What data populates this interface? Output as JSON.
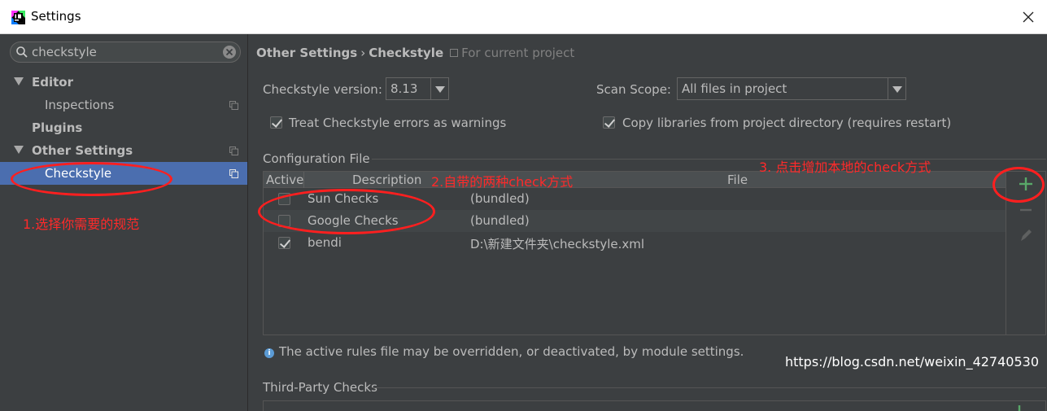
{
  "window": {
    "title": "Settings"
  },
  "search": {
    "value": "checkstyle"
  },
  "tree": {
    "editor": "Editor",
    "inspections": "Inspections",
    "plugins": "Plugins",
    "other_settings": "Other Settings",
    "checkstyle": "Checkstyle"
  },
  "breadcrumb": {
    "parent": "Other Settings",
    "separator": "›",
    "current": "Checkstyle",
    "scope_note": "For current project"
  },
  "form": {
    "version_label": "Checkstyle version:",
    "version_value": "8.13",
    "scope_label": "Scan Scope:",
    "scope_value": "All files in project",
    "treat_errors_label": "Treat Checkstyle errors as warnings",
    "treat_errors_checked": true,
    "copy_libs_label": "Copy libraries from project directory (requires restart)",
    "copy_libs_checked": true
  },
  "config": {
    "section_title": "Configuration File",
    "columns": {
      "active": "Active",
      "description": "Description",
      "file": "File"
    },
    "rows": [
      {
        "active": false,
        "description": "Sun Checks",
        "file": "(bundled)"
      },
      {
        "active": false,
        "description": "Google Checks",
        "file": "(bundled)"
      },
      {
        "active": true,
        "description": "bendi",
        "file": "D:\\新建文件夹\\checkstyle.xml"
      }
    ],
    "tools": {
      "add": "plus-icon",
      "remove": "minus-icon",
      "edit": "pencil-icon"
    }
  },
  "info_text": "The active rules file may be overridden, or deactivated, by module settings.",
  "third_party": {
    "section_title": "Third-Party Checks"
  },
  "annotations": {
    "a1": "1.选择你需要的规范",
    "a2": "2.自带的两种check方式",
    "a3": "3.     点击增加本地的check方式"
  },
  "watermark": "https://blog.csdn.net/weixin_42740530",
  "colors": {
    "background": "#3c3f41",
    "selection": "#4b6eaf",
    "annotation": "#ff2a2a",
    "add_green": "#59a869"
  }
}
